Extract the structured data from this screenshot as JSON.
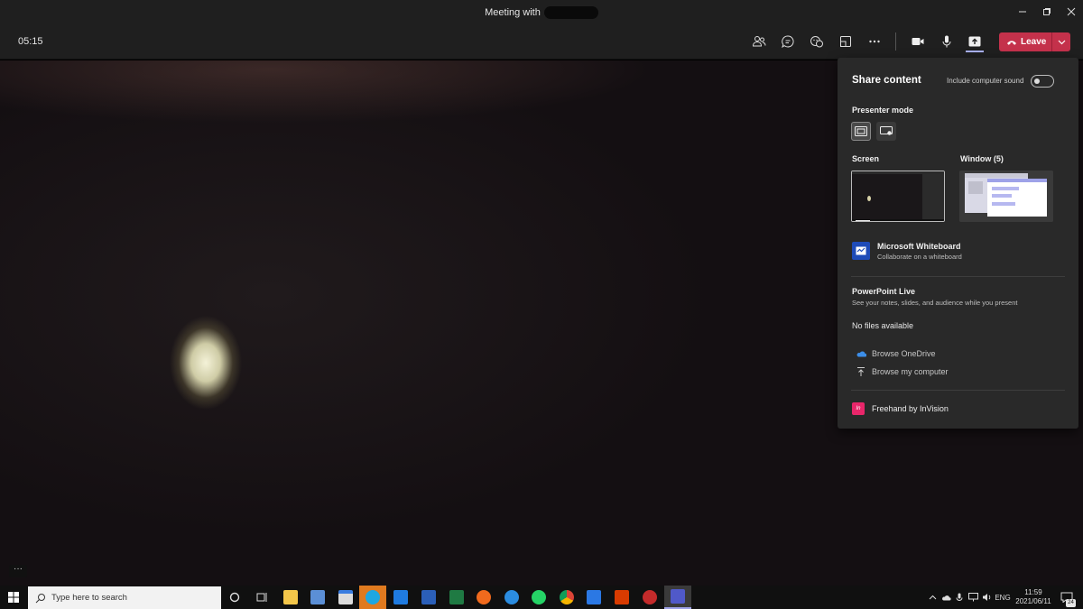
{
  "window": {
    "title": "Meeting with",
    "controls": [
      "minimize-icon",
      "restore-icon",
      "close-icon"
    ]
  },
  "toolbar": {
    "timer": "05:15",
    "buttons": [
      "people-icon",
      "chat-icon",
      "reactions-icon",
      "rooms-icon",
      "more-icon",
      "camera-icon",
      "mic-icon",
      "share-icon"
    ],
    "leave_label": "Leave",
    "leave_color": "#c4314b"
  },
  "share_panel": {
    "title": "Share content",
    "include_sound_label": "Include computer sound",
    "include_sound_on": false,
    "presenter_mode_label": "Presenter mode",
    "screen_label": "Screen",
    "window_label": "Window (5)",
    "whiteboard": {
      "name": "Microsoft Whiteboard",
      "sub": "Collaborate on a whiteboard"
    },
    "powerpoint": {
      "title": "PowerPoint Live",
      "sub": "See your notes, slides, and audience while you present",
      "empty": "No files available"
    },
    "browse_onedrive": "Browse OneDrive",
    "browse_computer": "Browse my computer",
    "freehand": {
      "icon_text": "In",
      "name": "Freehand by InVision"
    }
  },
  "stage": {
    "more_label": "···"
  },
  "taskbar": {
    "search_placeholder": "Type here to search",
    "apps": [
      "cortana-icon",
      "task-view-icon",
      "file-explorer-icon",
      "calculator-icon",
      "store-icon",
      "skype-icon",
      "mail-icon",
      "word-icon",
      "excel-icon",
      "firefox-icon",
      "edge-icon",
      "whatsapp-icon",
      "chrome-icon",
      "whiteboard-icon",
      "office-icon",
      "app-icon",
      "teams-icon"
    ],
    "language": "ENG",
    "time": "11:59",
    "date": "2021/06/11",
    "notifications": "24"
  }
}
